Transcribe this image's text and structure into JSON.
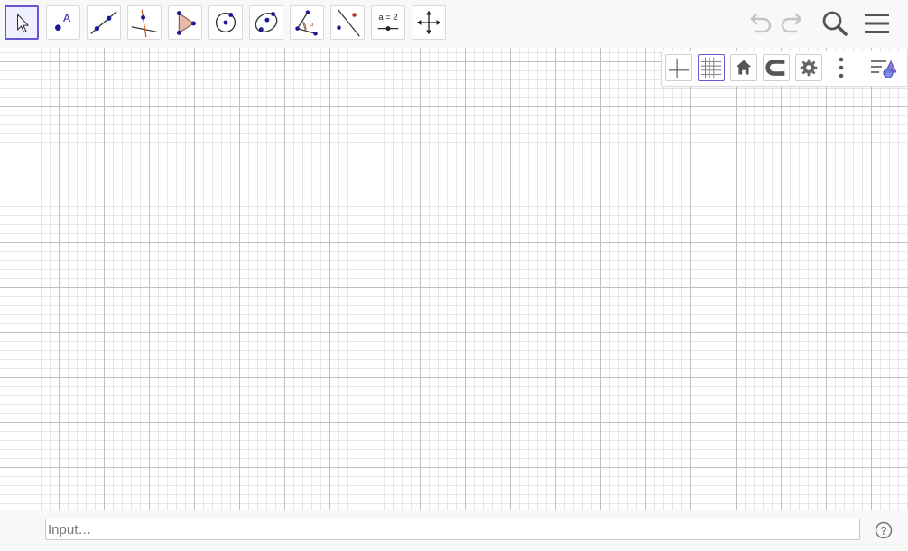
{
  "toolbar": {
    "tools": [
      {
        "name": "move",
        "icon": "move-arrow-icon",
        "active": true
      },
      {
        "name": "point",
        "icon": "point-icon",
        "label": "A"
      },
      {
        "name": "line",
        "icon": "line-through-two-points-icon"
      },
      {
        "name": "perpendicular-line",
        "icon": "perpendicular-line-icon"
      },
      {
        "name": "polygon",
        "icon": "polygon-icon"
      },
      {
        "name": "circle-center-point",
        "icon": "circle-center-point-icon"
      },
      {
        "name": "ellipse",
        "icon": "conic-through-points-icon"
      },
      {
        "name": "angle",
        "icon": "angle-icon"
      },
      {
        "name": "reflect-about-line",
        "icon": "reflect-about-line-icon"
      },
      {
        "name": "slider",
        "icon": "slider-icon",
        "label": "a = 2"
      },
      {
        "name": "move-graphics-view",
        "icon": "move-graphics-view-icon"
      }
    ],
    "undo_icon": "undo-icon",
    "redo_icon": "redo-icon",
    "search_icon": "search-icon",
    "menu_icon": "hamburger-menu-icon"
  },
  "style_bar": {
    "buttons": [
      {
        "name": "show-axes",
        "icon": "axes-icon",
        "active": false
      },
      {
        "name": "show-grid",
        "icon": "grid-icon",
        "active": true
      },
      {
        "name": "standard-view",
        "icon": "home-icon"
      },
      {
        "name": "point-capturing",
        "icon": "magnet-icon"
      },
      {
        "name": "graphics-settings",
        "icon": "gear-icon"
      },
      {
        "name": "more",
        "icon": "vertical-dots-icon"
      },
      {
        "name": "toggle-style-bar",
        "icon": "style-bar-toggle-icon"
      }
    ]
  },
  "graphics_view": {
    "grid": true,
    "axes": false
  },
  "input_bar": {
    "placeholder": "Input…",
    "help_icon": "help-icon",
    "help_label": "?"
  },
  "colors": {
    "accent": "#6557d2",
    "point": "#1a1a99",
    "toolbar_bg": "#f8f8f8",
    "grid_major": "#c0c0c0",
    "grid_minor": "#e6e6e6"
  }
}
